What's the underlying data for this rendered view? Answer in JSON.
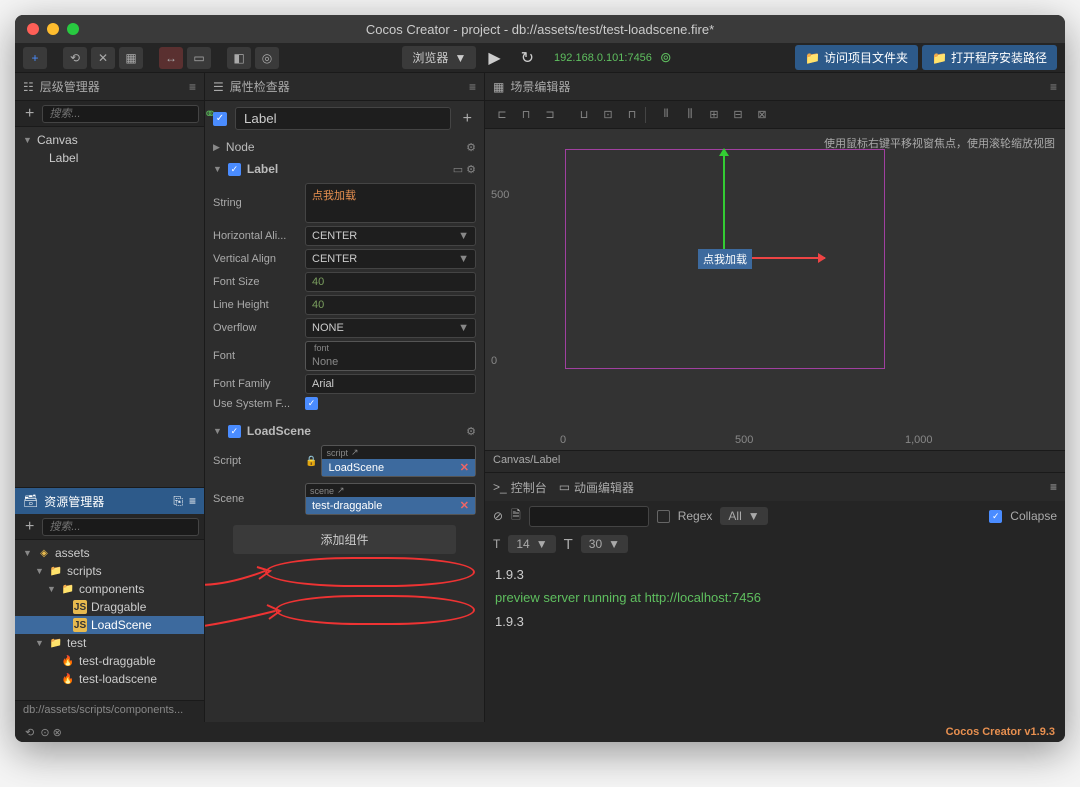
{
  "window": {
    "title": "Cocos Creator - project - db://assets/test/test-loadscene.fire*"
  },
  "toolbar": {
    "preview_dropdown": "浏览器",
    "ip": "192.168.0.101:7456",
    "btn_open_folder": "访问项目文件夹",
    "btn_open_path": "打开程序安装路径"
  },
  "hierarchy": {
    "title": "层级管理器",
    "search_placeholder": "搜索...",
    "root": "Canvas",
    "child": "Label"
  },
  "assets": {
    "title": "资源管理器",
    "search_placeholder": "搜索...",
    "root": "assets",
    "tree": {
      "scripts": "scripts",
      "components": "components",
      "draggable": "Draggable",
      "loadscene": "LoadScene",
      "test": "test",
      "test_draggable": "test-draggable",
      "test_loadscene": "test-loadscene"
    },
    "path": "db://assets/scripts/components..."
  },
  "inspector": {
    "title": "属性检查器",
    "node_name": "Label",
    "section_node": "Node",
    "section_label": "Label",
    "props": {
      "string_label": "String",
      "string_value": "点我加载",
      "halign_label": "Horizontal Ali...",
      "halign_value": "CENTER",
      "valign_label": "Vertical Align",
      "valign_value": "CENTER",
      "fontsize_label": "Font Size",
      "fontsize_value": "40",
      "lineheight_label": "Line Height",
      "lineheight_value": "40",
      "overflow_label": "Overflow",
      "overflow_value": "NONE",
      "font_label": "Font",
      "font_type": "font",
      "font_value": "None",
      "fontfamily_label": "Font Family",
      "fontfamily_value": "Arial",
      "usesystem_label": "Use System F..."
    },
    "section_loadscene": "LoadScene",
    "loadscene": {
      "script_label": "Script",
      "script_type": "script",
      "script_value": "LoadScene",
      "scene_label": "Scene",
      "scene_type": "scene",
      "scene_value": "test-draggable"
    },
    "add_component": "添加组件"
  },
  "scene": {
    "title": "场景编辑器",
    "hint": "使用鼠标右键平移视窗焦点，使用滚轮缩放视图",
    "label_text": "点我加载",
    "tick_500a": "500",
    "tick_0": "0",
    "tick_500b": "500",
    "tick_1000": "1,000",
    "status": "Canvas/Label"
  },
  "console": {
    "tab_console": "控制台",
    "tab_anim": "动画编辑器",
    "regex_label": "Regex",
    "filter_all": "All",
    "collapse_label": "Collapse",
    "font_size1": "14",
    "font_size2": "30",
    "line1": "1.9.3",
    "line2": "preview server running at http://localhost:7456",
    "line3": "1.9.3"
  },
  "footer": {
    "version": "Cocos Creator v1.9.3"
  }
}
